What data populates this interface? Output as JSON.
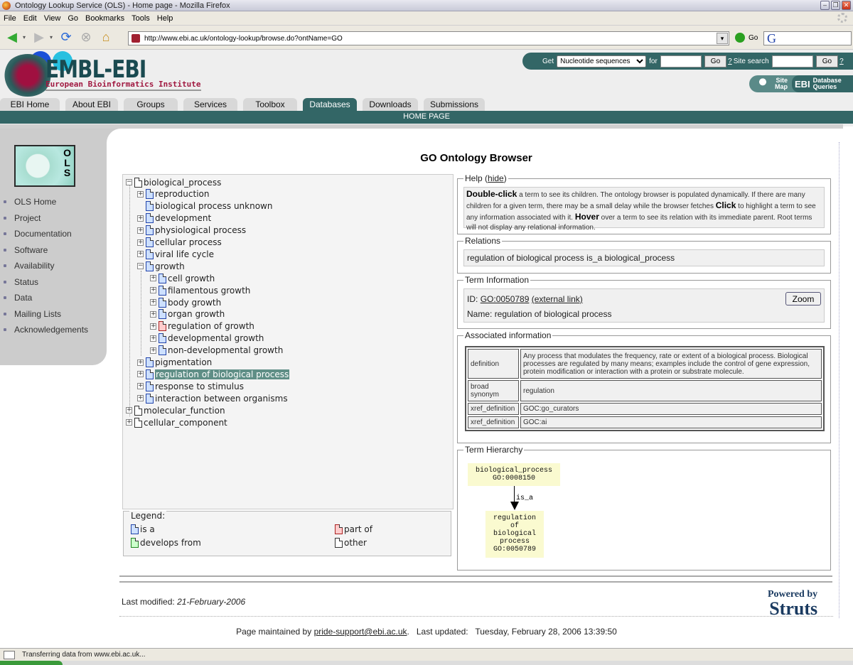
{
  "browser": {
    "title": "Ontology Lookup Service (OLS) - Home page - Mozilla Firefox",
    "menu": [
      "File",
      "Edit",
      "View",
      "Go",
      "Bookmarks",
      "Tools",
      "Help"
    ],
    "url": "http://www.ebi.ac.uk/ontology-lookup/browse.do?ontName=GO",
    "go_label": "Go",
    "search_engine_glyph": "G",
    "status_text": "Transferring data from www.ebi.ac.uk..."
  },
  "header": {
    "logo_text": "EMBL-EBI",
    "logo_subtitle": "European Bioinformatics Institute",
    "get_label": "Get",
    "get_select": "Nucleotide sequences",
    "for_label": "for",
    "go_button": "Go",
    "help_q": "?",
    "site_search_label": "Site search",
    "site_map": [
      "Site",
      "Map"
    ],
    "ebi_badge": "EBI",
    "database_queries": [
      "Database",
      "Queries"
    ],
    "tabs": [
      {
        "label": "EBI Home",
        "active": false
      },
      {
        "label": "About EBI",
        "active": false
      },
      {
        "label": "Groups",
        "active": false
      },
      {
        "label": "Services",
        "active": false
      },
      {
        "label": "Toolbox",
        "active": false
      },
      {
        "label": "Databases",
        "active": true
      },
      {
        "label": "Downloads",
        "active": false
      },
      {
        "label": "Submissions",
        "active": false
      }
    ],
    "subnav": "HOME PAGE"
  },
  "sidebar": {
    "logo_letters": [
      "O",
      "L",
      "S"
    ],
    "items": [
      "OLS Home",
      "Project",
      "Documentation",
      "Software",
      "Availability",
      "Status",
      "Data",
      "Mailing Lists",
      "Acknowledgements"
    ]
  },
  "main": {
    "title": "GO Ontology Browser",
    "tree": [
      {
        "label": "biological_process",
        "level": 0,
        "toggle": "minus",
        "type": "other"
      },
      {
        "label": "reproduction",
        "level": 1,
        "toggle": "plus",
        "type": "is_a"
      },
      {
        "label": "biological process unknown",
        "level": 1,
        "toggle": "none",
        "type": "is_a"
      },
      {
        "label": "development",
        "level": 1,
        "toggle": "plus",
        "type": "is_a"
      },
      {
        "label": "physiological process",
        "level": 1,
        "toggle": "plus",
        "type": "is_a"
      },
      {
        "label": "cellular process",
        "level": 1,
        "toggle": "plus",
        "type": "is_a"
      },
      {
        "label": "viral life cycle",
        "level": 1,
        "toggle": "plus",
        "type": "is_a"
      },
      {
        "label": "growth",
        "level": 1,
        "toggle": "minus",
        "type": "is_a"
      },
      {
        "label": "cell growth",
        "level": 2,
        "toggle": "plus",
        "type": "is_a"
      },
      {
        "label": "filamentous growth",
        "level": 2,
        "toggle": "plus",
        "type": "is_a"
      },
      {
        "label": "body growth",
        "level": 2,
        "toggle": "plus",
        "type": "is_a"
      },
      {
        "label": "organ growth",
        "level": 2,
        "toggle": "plus",
        "type": "is_a"
      },
      {
        "label": "regulation of growth",
        "level": 2,
        "toggle": "plus",
        "type": "part_of"
      },
      {
        "label": "developmental growth",
        "level": 2,
        "toggle": "plus",
        "type": "is_a"
      },
      {
        "label": "non-developmental growth",
        "level": 2,
        "toggle": "plus",
        "type": "is_a"
      },
      {
        "label": "pigmentation",
        "level": 1,
        "toggle": "plus",
        "type": "is_a"
      },
      {
        "label": "regulation of biological process",
        "level": 1,
        "toggle": "plus",
        "type": "is_a",
        "selected": true
      },
      {
        "label": "response to stimulus",
        "level": 1,
        "toggle": "plus",
        "type": "is_a"
      },
      {
        "label": "interaction between organisms",
        "level": 1,
        "toggle": "plus",
        "type": "is_a"
      },
      {
        "label": "molecular_function",
        "level": 0,
        "toggle": "plus",
        "type": "other"
      },
      {
        "label": "cellular_component",
        "level": 0,
        "toggle": "plus",
        "type": "other"
      }
    ],
    "legend": {
      "title": "Legend:",
      "items": [
        {
          "label": "is a",
          "color": "blue"
        },
        {
          "label": "part of",
          "color": "red"
        },
        {
          "label": "develops from",
          "color": "green"
        },
        {
          "label": "other",
          "color": "white"
        }
      ]
    },
    "help": {
      "title": "Help (",
      "hide_link": "hide",
      "title_close": ")",
      "b1": "Double-click",
      "t1": " a term to see its children. The ontology browser is populated dynamically. If there are many children for a given term, there may be a small delay while the browser fetches ",
      "b2": "Click",
      "t2": " to highlight a term to see any information associated with it. ",
      "b3": "Hover",
      "t3": " over a term to see its relation with its immediate parent. Root terms will not display any relational information."
    },
    "relations": {
      "title": "Relations",
      "text": "regulation of biological process is_a biological_process"
    },
    "term_info": {
      "title": "Term Information",
      "id_label": "ID:",
      "id": "GO:0050789",
      "external_link": "(external link)",
      "name_label": "Name:",
      "name": "regulation of biological process",
      "zoom_button": "Zoom"
    },
    "associated": {
      "title": "Associated information",
      "rows": [
        {
          "key": "definition",
          "value": "Any process that modulates the frequency, rate or extent of a biological process. Biological processes are regulated by many means; examples include the control of gene expression, protein modification or interaction with a protein or substrate molecule."
        },
        {
          "key": "broad synonym",
          "value": "regulation"
        },
        {
          "key": "xref_definition",
          "value": "GOC:go_curators"
        },
        {
          "key": "xref_definition",
          "value": "GOC:ai"
        }
      ]
    },
    "hierarchy": {
      "title": "Term Hierarchy",
      "parent": {
        "name": "biological_process",
        "id": "GO:0008150"
      },
      "edge_label": "is_a",
      "child": {
        "name_lines": [
          "regulation",
          "of",
          "biological",
          "process"
        ],
        "id": "GO:0050789"
      }
    }
  },
  "footer": {
    "last_modified_label": "Last modified:",
    "last_modified": "21-February-2006",
    "powered_by": "Powered by",
    "struts": "Struts",
    "maintained_label": "Page maintained by",
    "email": "pride-support@ebi.ac.uk",
    "last_updated_label": "Last updated:",
    "last_updated": "Tuesday, February 28, 2006 13:39:50"
  }
}
